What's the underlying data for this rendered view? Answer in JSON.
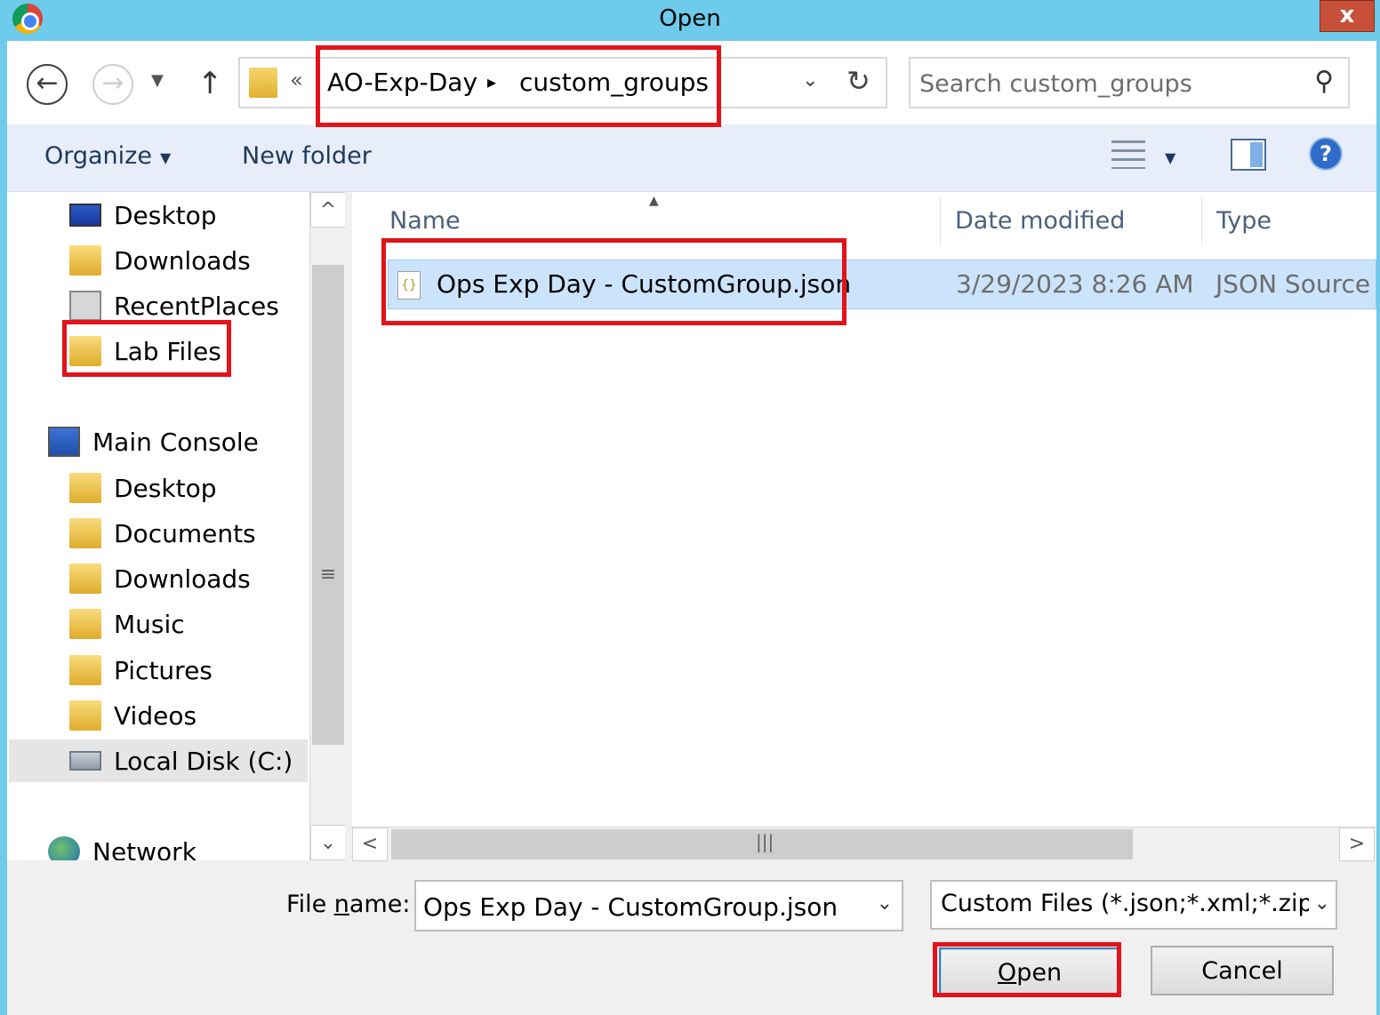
{
  "window": {
    "title": "Open",
    "close_label": "x"
  },
  "address": {
    "overflow": "«",
    "segments": [
      "AO-Exp-Day",
      "custom_groups"
    ],
    "separator": "▸"
  },
  "search": {
    "placeholder": "Search custom_groups"
  },
  "toolbar": {
    "organize": "Organize",
    "new_folder": "New folder",
    "help": "?"
  },
  "nav": {
    "favorites": [
      {
        "label": "Desktop",
        "icon": "desktop-icon"
      },
      {
        "label": "Downloads",
        "icon": "downloads-folder-icon"
      },
      {
        "label": "RecentPlaces",
        "icon": "recent-places-icon"
      },
      {
        "label": "Lab Files",
        "icon": "folder-icon"
      }
    ],
    "computer": {
      "label": "Main Console",
      "icon": "computer-icon"
    },
    "computer_items": [
      {
        "label": "Desktop",
        "icon": "desktop-folder-icon"
      },
      {
        "label": "Documents",
        "icon": "documents-folder-icon"
      },
      {
        "label": "Downloads",
        "icon": "downloads-folder-icon"
      },
      {
        "label": "Music",
        "icon": "music-folder-icon"
      },
      {
        "label": "Pictures",
        "icon": "pictures-folder-icon"
      },
      {
        "label": "Videos",
        "icon": "videos-folder-icon"
      },
      {
        "label": "Local Disk (C:)",
        "icon": "disk-icon"
      }
    ],
    "network": {
      "label": "Network",
      "icon": "network-icon"
    }
  },
  "columns": {
    "name": "Name",
    "date": "Date modified",
    "type": "Type"
  },
  "files": [
    {
      "name": "Ops Exp Day - CustomGroup.json",
      "date": "3/29/2023 8:26 AM",
      "type": "JSON Source F"
    }
  ],
  "footer": {
    "file_name_label_pre": "File ",
    "file_name_label_ul": "n",
    "file_name_label_post": "ame:",
    "file_name_value": "Ops Exp Day - CustomGroup.json",
    "filter": "Custom Files (*.json;*.xml;*.zip;",
    "open_ul": "O",
    "open_rest": "pen",
    "cancel": "Cancel"
  },
  "colors": {
    "titlebar": "#6ecbec",
    "highlight": "#e3131b",
    "selection": "#cce4fb"
  }
}
